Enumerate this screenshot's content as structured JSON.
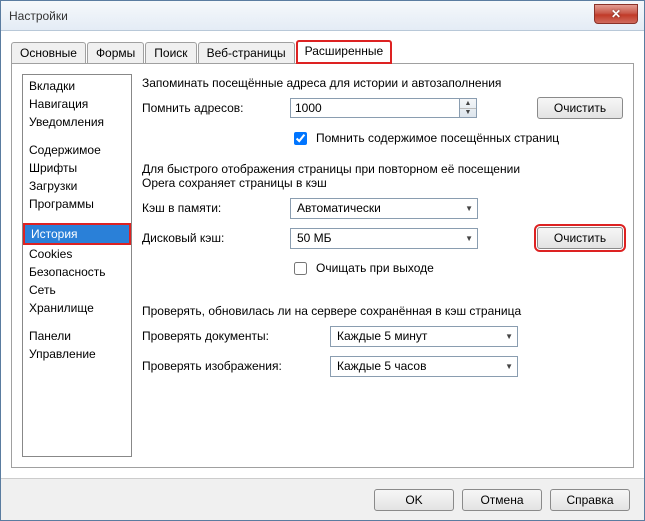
{
  "window": {
    "title": "Настройки",
    "close": "✕"
  },
  "tabs": {
    "t0": "Основные",
    "t1": "Формы",
    "t2": "Поиск",
    "t3": "Веб-страницы",
    "t4": "Расширенные"
  },
  "sidebar": {
    "g1": {
      "i0": "Вкладки",
      "i1": "Навигация",
      "i2": "Уведомления"
    },
    "g2": {
      "i0": "Содержимое",
      "i1": "Шрифты",
      "i2": "Загрузки",
      "i3": "Программы"
    },
    "g3": {
      "i0": "История",
      "i1": "Cookies",
      "i2": "Безопасность",
      "i3": "Сеть",
      "i4": "Хранилище"
    },
    "g4": {
      "i0": "Панели",
      "i1": "Управление"
    }
  },
  "main": {
    "desc1": "Запоминать посещённые адреса для истории и автозаполнения",
    "rememberLabel": "Помнить адресов:",
    "rememberValue": "1000",
    "clear1": "Очистить",
    "chk1": "Помнить содержимое посещённых страниц",
    "desc2a": "Для быстрого отображения страницы при повторном её посещении",
    "desc2b": "Opera сохраняет страницы в кэш",
    "memCacheLabel": "Кэш в памяти:",
    "memCacheValue": "Автоматически",
    "diskCacheLabel": "Дисковый кэш:",
    "diskCacheValue": "50 МБ",
    "clear2": "Очистить",
    "chk2": "Очищать при выходе",
    "desc3": "Проверять, обновилась ли на сервере сохранённая в кэш страница",
    "checkDocsLabel": "Проверять документы:",
    "checkDocsValue": "Каждые 5 минут",
    "checkImgsLabel": "Проверять изображения:",
    "checkImgsValue": "Каждые 5 часов"
  },
  "footer": {
    "ok": "OK",
    "cancel": "Отмена",
    "help": "Справка"
  }
}
